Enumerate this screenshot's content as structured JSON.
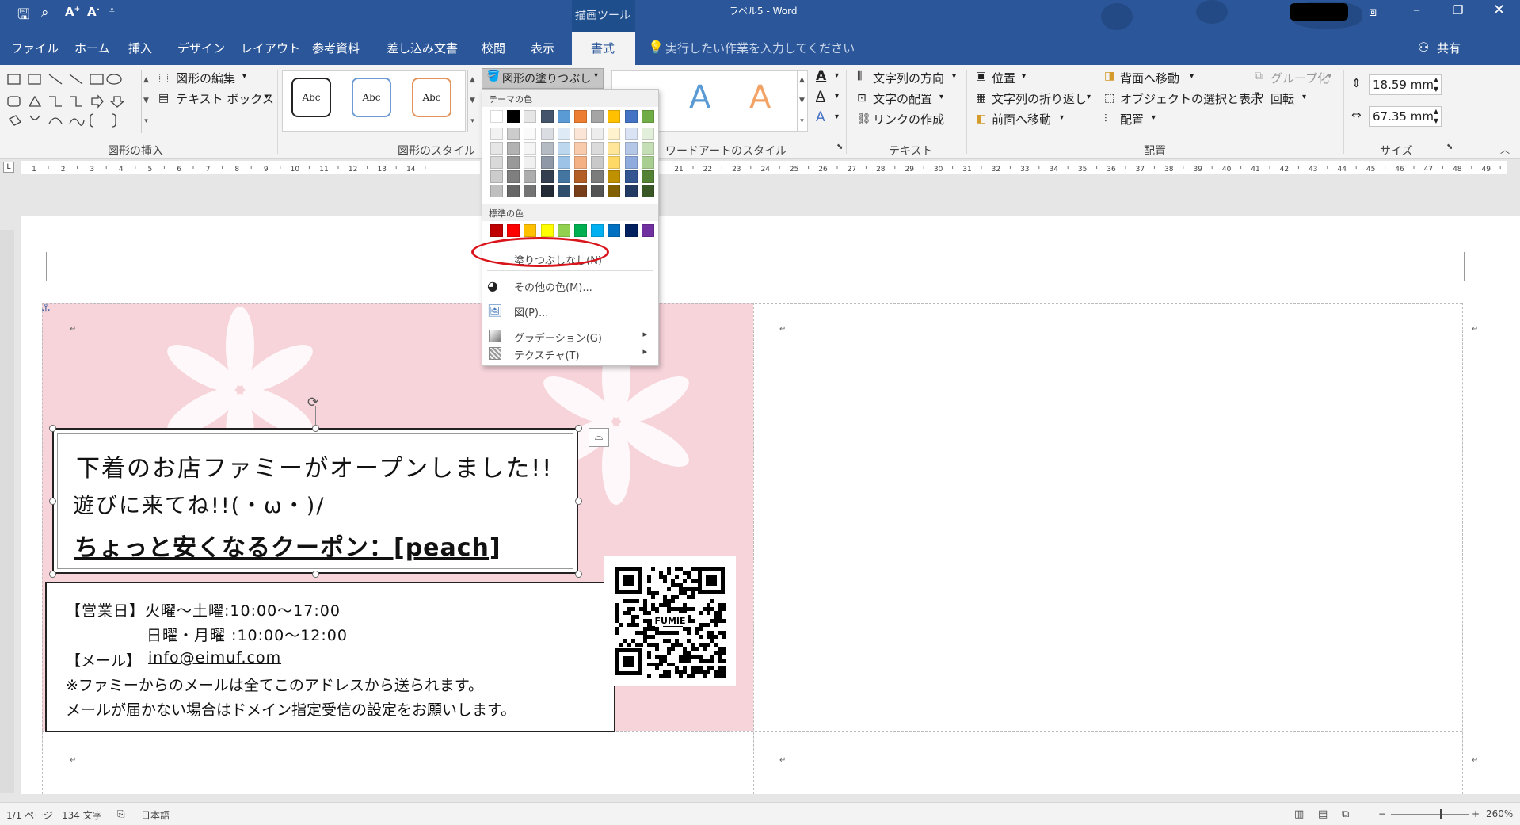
{
  "titlebar": {
    "drawing_tools": "描画ツール",
    "title": "ラベル5 - Word",
    "qat": [
      "save-icon",
      "print-preview-icon",
      "font-grow-icon",
      "font-shrink-icon",
      "customize-icon"
    ]
  },
  "tabs": [
    "ファイル",
    "ホーム",
    "挿入",
    "デザイン",
    "レイアウト",
    "参考資料",
    "差し込み文書",
    "校閲",
    "表示",
    "書式"
  ],
  "tell_me": "実行したい作業を入力してください",
  "share": "共有",
  "ribbon": {
    "edit_shape": "図形の編集",
    "text_box": "テキスト ボックス",
    "group_insert": "図形の挿入",
    "style_abc": "Abc",
    "group_styles": "図形のスタイル",
    "fill_button": "図形の塗りつぶし",
    "group_wordart": "ワードアートのスタイル",
    "wordart_letter": "A",
    "text_direction": "文字列の方向",
    "text_align": "文字の配置",
    "create_link": "リンクの作成",
    "group_text": "テキスト",
    "position": "位置",
    "wrap_text": "文字列の折り返し",
    "bring_forward": "前面へ移動",
    "send_backward": "背面へ移動",
    "selection_pane": "オブジェクトの選択と表示",
    "align": "配置",
    "group": "グループ化",
    "rotate": "回転",
    "group_arrange": "配置",
    "height": "18.59 mm",
    "width": "67.35 mm",
    "group_size": "サイズ"
  },
  "ruler_numbers": [
    "1",
    "2",
    "3",
    "4",
    "5",
    "6",
    "7",
    "8",
    "9",
    "10",
    "11",
    "12",
    "13",
    "14",
    "21",
    "22",
    "23",
    "24",
    "25",
    "26",
    "27",
    "28",
    "29",
    "30",
    "31",
    "32",
    "33",
    "34",
    "35",
    "36",
    "37",
    "38",
    "39",
    "40",
    "41",
    "42",
    "43",
    "44",
    "45",
    "46",
    "47",
    "48",
    "49"
  ],
  "dropdown": {
    "theme_colors_label": "テーマの色",
    "standard_colors_label": "標準の色",
    "no_fill": "塗りつぶしなし(N)",
    "more_colors": "その他の色(M)...",
    "picture": "図(P)...",
    "gradient": "グラデーション(G)",
    "texture": "テクスチャ(T)",
    "theme_top": [
      "#ffffff",
      "#000000",
      "#e7e6e6",
      "#44546a",
      "#5b9bd5",
      "#ed7d31",
      "#a5a5a5",
      "#ffc000",
      "#4472c4",
      "#70ad47"
    ],
    "standard": [
      "#c00000",
      "#ff0000",
      "#ffc000",
      "#ffff00",
      "#92d050",
      "#00b050",
      "#00b0f0",
      "#0070c0",
      "#002060",
      "#7030a0"
    ],
    "highlight_color": "#d9141b"
  },
  "doc": {
    "headline1": "下着のお店ファミーがオープンしました!!",
    "headline2": "遊びに来てね!!(・ω・)/",
    "headline3": "ちょっと安くなるクーポン：[peach]",
    "info1": "【営業日】火曜～土曜:10:00～17:00",
    "info2": "日曜・月曜 :10:00～12:00",
    "info3_label": "【メール】",
    "info3_mail": "info@eimuf.com",
    "info4": "※ファミーからのメールは全てこのアドレスから送られます。",
    "info5": "メールが届かない場合はドメイン指定受信の設定をお願いします。",
    "qr_text": "FUMIE",
    "label_bg": "#f7d3da"
  },
  "status": {
    "page": "1/1 ページ",
    "words": "134 文字",
    "lang": "日本語",
    "zoom": "260%"
  }
}
